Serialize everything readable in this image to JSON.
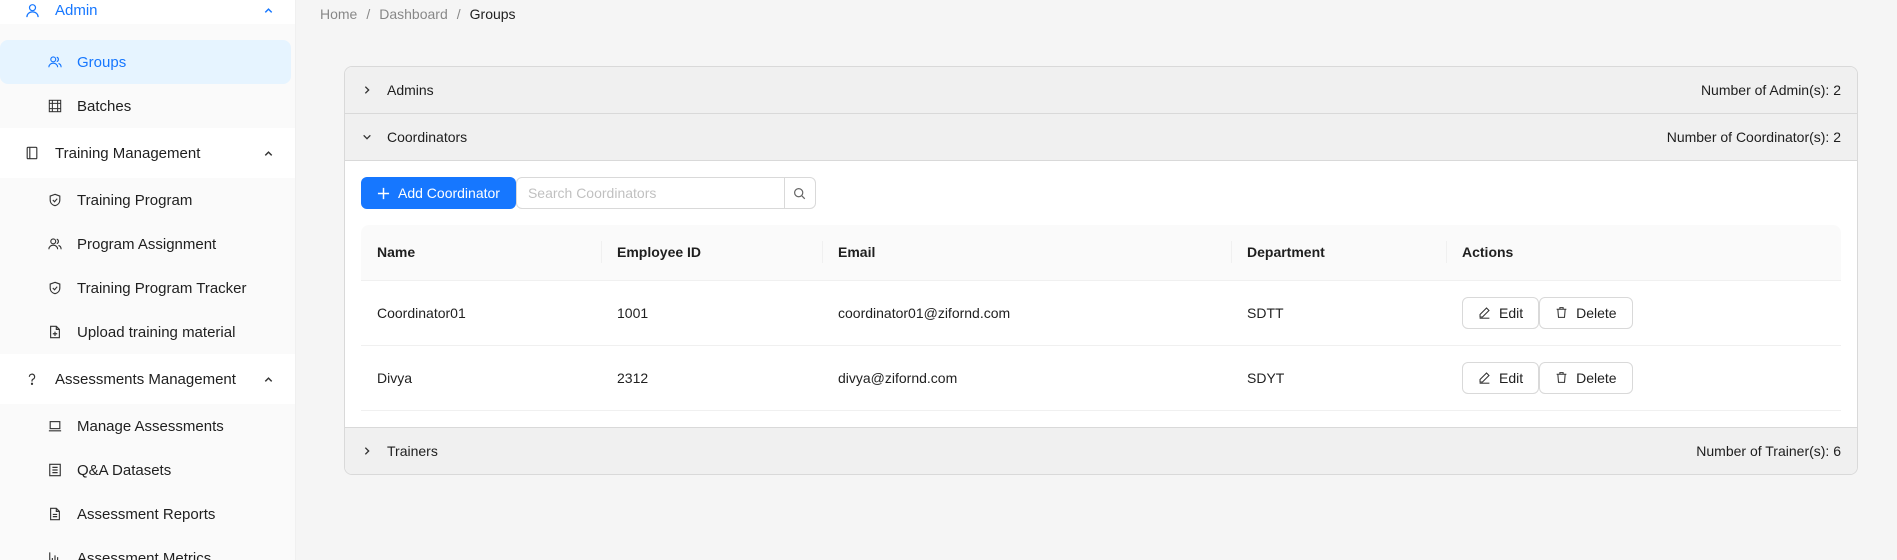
{
  "sidebar": {
    "admin": {
      "label": "Admin",
      "items": [
        {
          "label": "Groups",
          "icon": "groups-icon"
        },
        {
          "label": "Batches",
          "icon": "batches-icon"
        }
      ]
    },
    "training": {
      "label": "Training Management",
      "items": [
        {
          "label": "Training Program"
        },
        {
          "label": "Program Assignment"
        },
        {
          "label": "Training Program Tracker"
        },
        {
          "label": "Upload training material"
        }
      ]
    },
    "assessments": {
      "label": "Assessments Management",
      "items": [
        {
          "label": "Manage Assessments"
        },
        {
          "label": "Q&A Datasets"
        },
        {
          "label": "Assessment Reports"
        },
        {
          "label": "Assessment Metrics"
        }
      ]
    }
  },
  "breadcrumb": {
    "home": "Home",
    "dashboard": "Dashboard",
    "current": "Groups",
    "separator": "/"
  },
  "panels": {
    "admins": {
      "title": "Admins",
      "count": "Number of Admin(s): 2"
    },
    "coordinators": {
      "title": "Coordinators",
      "count": "Number of Coordinator(s): 2"
    },
    "trainers": {
      "title": "Trainers",
      "count": "Number of Trainer(s): 6"
    }
  },
  "toolbar": {
    "add_label": "Add Coordinator",
    "search_placeholder": "Search Coordinators"
  },
  "table": {
    "columns": [
      "Name",
      "Employee ID",
      "Email",
      "Department",
      "Actions"
    ],
    "rows": [
      {
        "name": "Coordinator01",
        "employee_id": "1001",
        "email": "coordinator01@zifornd.com",
        "department": "SDTT"
      },
      {
        "name": "Divya",
        "employee_id": "2312",
        "email": "divya@zifornd.com",
        "department": "SDYT"
      }
    ],
    "edit_label": "Edit",
    "delete_label": "Delete"
  },
  "colors": {
    "primary": "#1677ff",
    "selected_bg": "#e6f4ff"
  }
}
